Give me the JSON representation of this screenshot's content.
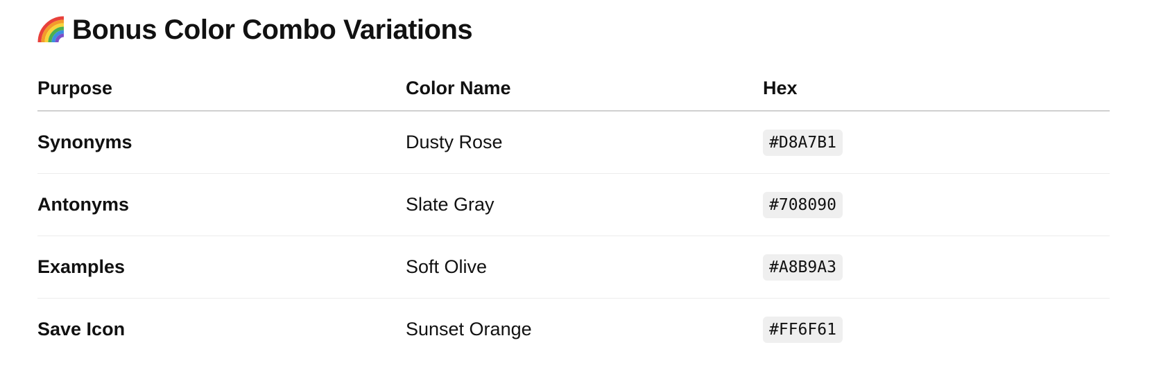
{
  "heading": {
    "icon": "rainbow-icon",
    "title": "Bonus Color Combo Variations"
  },
  "table": {
    "headers": [
      "Purpose",
      "Color Name",
      "Hex"
    ],
    "rows": [
      {
        "purpose": "Synonyms",
        "color_name": "Dusty Rose",
        "hex": "#D8A7B1"
      },
      {
        "purpose": "Antonyms",
        "color_name": "Slate Gray",
        "hex": "#708090"
      },
      {
        "purpose": "Examples",
        "color_name": "Soft Olive",
        "hex": "#A8B9A3"
      },
      {
        "purpose": "Save Icon",
        "color_name": "Sunset Orange",
        "hex": "#FF6F61"
      }
    ]
  },
  "colors": {
    "code_background": "#EFEFEF",
    "header_rule": "#CFCFCF",
    "row_rule": "#ECECEC",
    "text": "#111111"
  }
}
